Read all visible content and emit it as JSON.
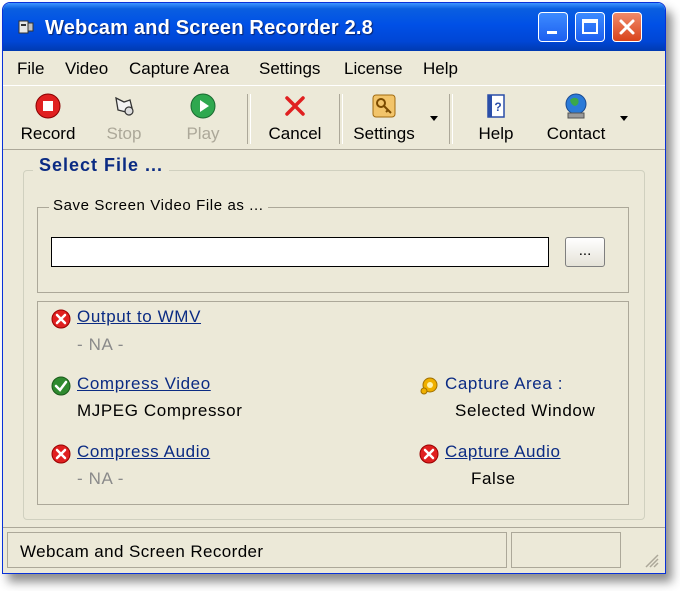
{
  "window": {
    "title": "Webcam and Screen Recorder 2.8"
  },
  "menu": [
    "File",
    "Video",
    "Capture Area",
    "Settings",
    "License",
    "Help"
  ],
  "toolbar": {
    "record": "Record",
    "stop": "Stop",
    "play": "Play",
    "cancel": "Cancel",
    "settings": "Settings",
    "help": "Help",
    "contact": "Contact"
  },
  "select_file": {
    "title": "Select File ...",
    "save_label": "Save Screen Video File as ...",
    "file_path": "",
    "browse_label": "..."
  },
  "options": {
    "output_wmv": {
      "label": "Output to WMV",
      "value": "- NA -",
      "status": "error"
    },
    "compress_video": {
      "label": "Compress Video",
      "value": "MJPEG Compressor",
      "status": "ok"
    },
    "compress_audio": {
      "label": "Compress Audio",
      "value": "- NA -",
      "status": "error"
    },
    "capture_area": {
      "label": "Capture Area :",
      "value": "Selected Window",
      "status": "info"
    },
    "capture_audio": {
      "label": "Capture Audio",
      "value": "False",
      "status": "error"
    }
  },
  "statusbar": {
    "text": "Webcam and Screen Recorder"
  },
  "colors": {
    "titlebar": "#0050e6",
    "link": "#0b2b83",
    "error": "#e02020",
    "ok": "#2f8a2f",
    "info": "#f0b000"
  }
}
